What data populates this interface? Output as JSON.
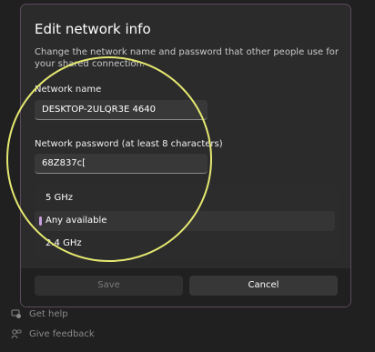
{
  "dialog": {
    "title": "Edit network info",
    "description": "Change the network name and password that other people use for your shared connection."
  },
  "network_name": {
    "label": "Network name",
    "value": "DESKTOP-2ULQR3E 4640"
  },
  "network_password": {
    "label": "Network password (at least 8 characters)",
    "value": "68Z837c["
  },
  "band_dropdown": {
    "options": [
      "5 GHz",
      "Any available",
      "2.4 GHz"
    ],
    "selected": "Any available",
    "accent_color": "#c8a0e0"
  },
  "buttons": {
    "save_label": "Save",
    "cancel_label": "Cancel"
  },
  "links": {
    "get_help": "Get help",
    "give_feedback": "Give feedback"
  },
  "annotation": {
    "shape": "circle",
    "color": "#e5e870"
  }
}
